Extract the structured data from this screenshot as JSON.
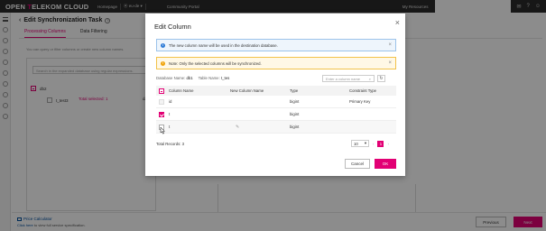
{
  "topbar": {
    "brand_prefix": "OPEN ",
    "brand_t": "T",
    "brand_rest": "ELEKOM CLOUD",
    "homepage": "Homepage",
    "region": "eu-de",
    "portal": "Community Portal",
    "my_resources": "My Resources"
  },
  "page": {
    "title": "Edit Synchronization Task",
    "tabs": [
      {
        "label": "Processing Columns"
      },
      {
        "label": "Data Filtering"
      }
    ],
    "hint": "You can query or filter columns or create new column names.",
    "search_placeholder": "Search in the expanded database using regular expressions.",
    "tree_db": "db2",
    "tree_table": "t_test3",
    "total_selected": "Total selected: 1",
    "db_label": "databa"
  },
  "footer": {
    "price_calculator": "Price Calculator",
    "click_here": "Click here",
    "spec_text": " to view full service specification.",
    "previous": "Previous",
    "next": "Next"
  },
  "modal": {
    "title": "Edit Column",
    "info": "The new column name will be used in the destination database.",
    "warning": "Note: Only the selected columns will be synchronized.",
    "db_name_label": "Database Name",
    "db_name_value": "db1",
    "table_name_label": "Table Name",
    "table_name_value": "t_tes",
    "search_placeholder": "Enter a column name",
    "columns": [
      "Column Name",
      "New Column Name",
      "Type",
      "Constraint Type"
    ],
    "rows": [
      {
        "name": "id",
        "new_name": "",
        "type": "bigint",
        "constraint": "Primary Key"
      },
      {
        "name": "t",
        "new_name": "",
        "type": "bigint",
        "constraint": ""
      },
      {
        "name": "t",
        "new_name": "",
        "type": "bigint",
        "constraint": ""
      }
    ],
    "total_records": "Total Records: 3",
    "page_size": "10",
    "current_page": "1",
    "cancel": "Cancel",
    "ok": "OK"
  },
  "colors": {
    "accent": "#e20074",
    "info": "#2e7bd6",
    "warning": "#f0a30a"
  }
}
